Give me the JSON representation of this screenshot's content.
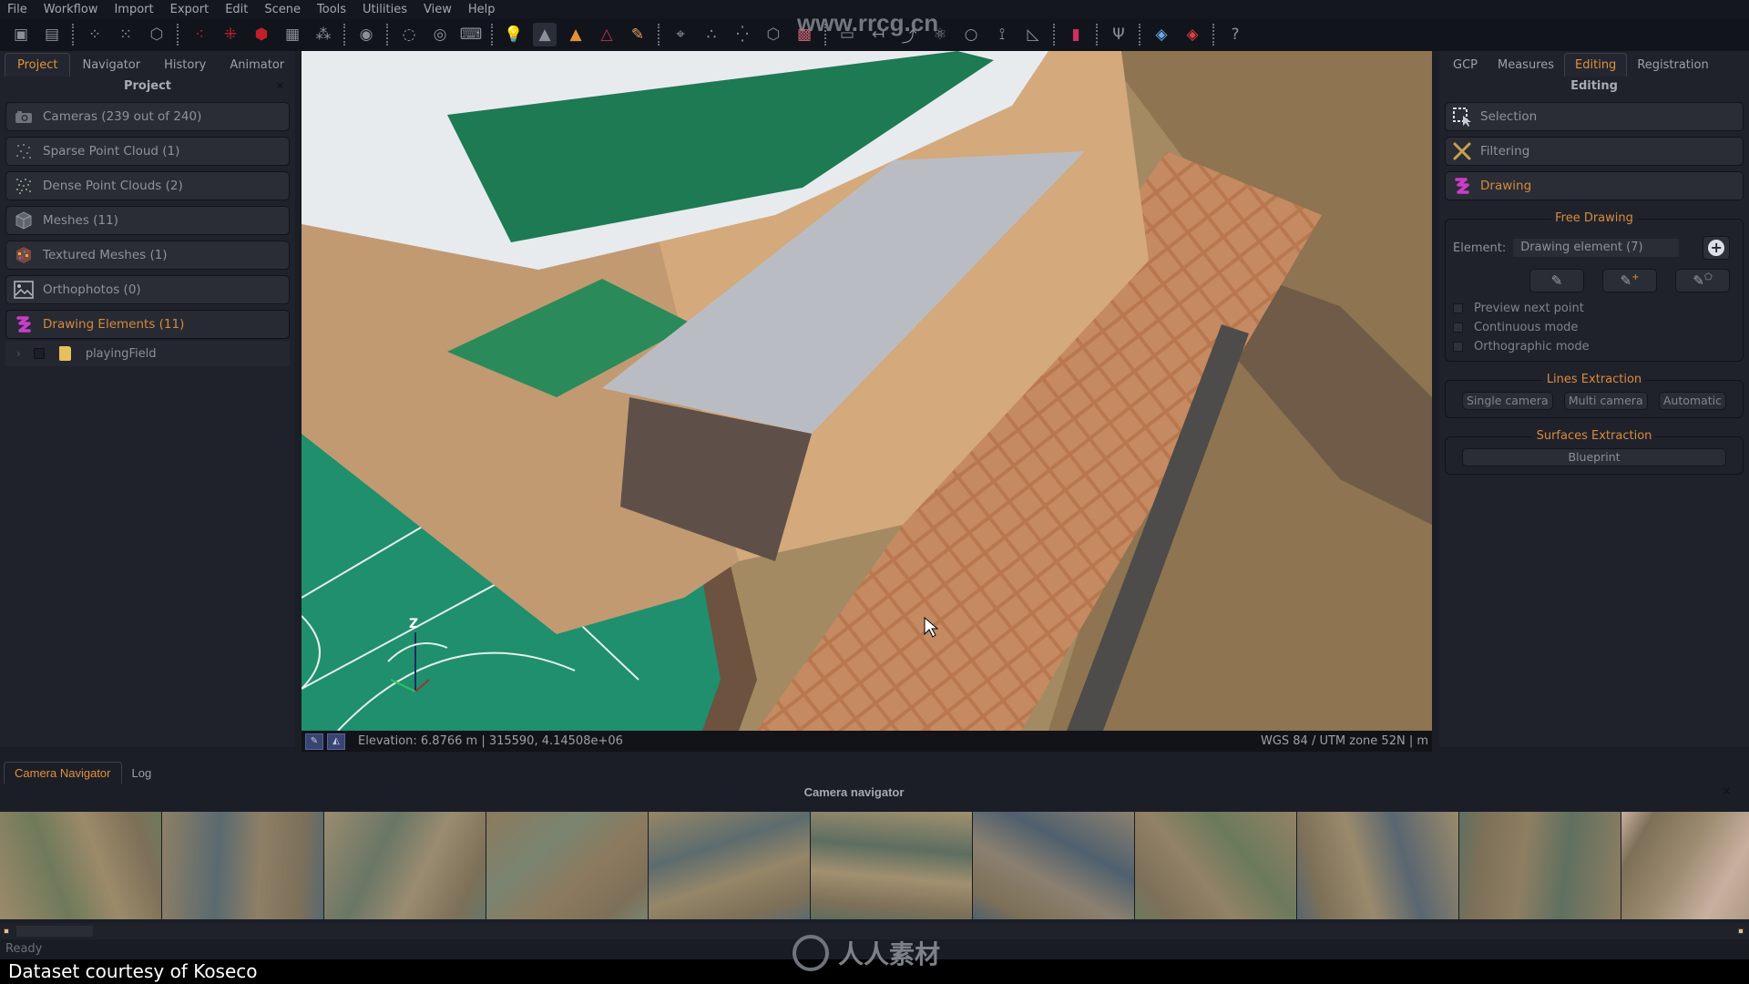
{
  "menu": [
    "File",
    "Workflow",
    "Import",
    "Export",
    "Edit",
    "Scene",
    "Tools",
    "Utilities",
    "View",
    "Help"
  ],
  "watermark": {
    "url": "www.rrcg.cn",
    "logo_text": "人人素材"
  },
  "toolbar": {
    "icons": [
      "new-project-icon",
      "save-icon",
      "sep",
      "sparse-cloud-icon",
      "dense-cloud-icon",
      "mesh-icon",
      "sep",
      "compute-sparse-icon",
      "compute-dense-icon",
      "compute-mesh-icon",
      "compute-texture-icon",
      "filter-cloud-icon",
      "sep",
      "camera-icon",
      "sep",
      "orbit-icon",
      "rotate-icon",
      "wasd-icon",
      "sep",
      "light-icon",
      "shading-flat-icon",
      "shading-color-icon",
      "shading-rgb-icon",
      "paint-brush-icon",
      "sep",
      "camera-select-icon",
      "sparse-view-icon",
      "dense-view-icon",
      "mesh-view-icon",
      "texture-view-icon",
      "sep",
      "ortho-icon",
      "measure-icon",
      "gcp-icon",
      "atom-icon",
      "loop-icon",
      "axis-icon",
      "ruler-icon",
      "sep",
      "chart-icon",
      "sep",
      "tool-icon",
      "sep",
      "blue-cube-icon",
      "red-cube-icon",
      "sep",
      "help-icon"
    ],
    "active": "shading-flat-icon"
  },
  "left_panel": {
    "tabs": [
      "Project",
      "Navigator",
      "History",
      "Animator"
    ],
    "active_tab": "Project",
    "title": "Project",
    "items": [
      {
        "label": "Cameras (239 out of 240)",
        "icon": "camera-icon"
      },
      {
        "label": "Sparse Point Cloud (1)",
        "icon": "sparse-cloud-icon"
      },
      {
        "label": "Dense Point Clouds (2)",
        "icon": "dense-cloud-icon"
      },
      {
        "label": "Meshes (11)",
        "icon": "mesh-icon"
      },
      {
        "label": "Textured Meshes (1)",
        "icon": "textured-mesh-icon"
      },
      {
        "label": "Orthophotos (0)",
        "icon": "orthophoto-icon"
      },
      {
        "label": "Drawing Elements (11)",
        "icon": "drawing-icon",
        "active": true
      }
    ],
    "tree": [
      {
        "label": "playingField",
        "checked": false
      }
    ]
  },
  "viewport": {
    "status": "Elevation: 6.8766 m | 315590, 4.14508e+06",
    "crs": "WGS 84 / UTM zone 52N | m",
    "axis_label": "Z"
  },
  "right_panel": {
    "tabs": [
      "GCP",
      "Measures",
      "Editing",
      "Registration"
    ],
    "active_tab": "Editing",
    "title": "Editing",
    "items": [
      {
        "label": "Selection",
        "icon": "selection-icon"
      },
      {
        "label": "Filtering",
        "icon": "filtering-icon"
      },
      {
        "label": "Drawing",
        "icon": "drawing-icon",
        "active": true
      }
    ],
    "free_drawing": {
      "title": "Free Drawing",
      "element_label": "Element:",
      "element_value": "Drawing element (7)",
      "tools": [
        "draw-line-icon",
        "draw-add-icon",
        "draw-polygon-icon"
      ],
      "options": [
        {
          "label": "Preview next point",
          "checked": false
        },
        {
          "label": "Continuous mode",
          "checked": false
        },
        {
          "label": "Orthographic mode",
          "checked": false
        }
      ]
    },
    "lines_extraction": {
      "title": "Lines Extraction",
      "buttons": [
        "Single camera",
        "Multi camera",
        "Automatic"
      ]
    },
    "surfaces_extraction": {
      "title": "Surfaces Extraction",
      "buttons": [
        "Blueprint"
      ]
    }
  },
  "bottom": {
    "tabs": [
      "Camera Navigator",
      "Log"
    ],
    "active_tab": "Camera Navigator",
    "title": "Camera navigator",
    "thumbnail_count": 11
  },
  "status": "Ready",
  "caption": "Dataset courtesy of Koseco",
  "colors": {
    "accent": "#e2913a",
    "panel": "#1f222b",
    "drawing": "#c93ec8"
  }
}
